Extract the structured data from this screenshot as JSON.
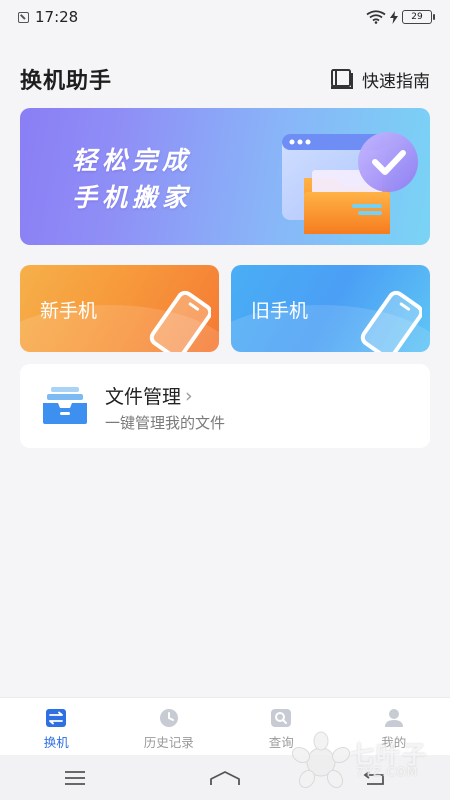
{
  "status_bar": {
    "time": "17:28",
    "battery": "29"
  },
  "header": {
    "title": "换机助手",
    "guide_label": "快速指南"
  },
  "banner": {
    "line1": "轻松完成",
    "line2": "手机搬家"
  },
  "cards": {
    "new_phone": "新手机",
    "old_phone": "旧手机"
  },
  "file_management": {
    "title": "文件管理",
    "subtitle": "一键管理我的文件"
  },
  "tabs": [
    {
      "label": "换机",
      "icon": "swap-icon",
      "active": true
    },
    {
      "label": "历史记录",
      "icon": "clock-icon",
      "active": false
    },
    {
      "label": "查询",
      "icon": "search-icon",
      "active": false
    },
    {
      "label": "我的",
      "icon": "person-icon",
      "active": false
    }
  ],
  "watermark": {
    "text": "七叶子",
    "domain": "7YZ.COM"
  },
  "colors": {
    "accent": "#2f6fe4",
    "new_phone_card": "#f79a3c",
    "old_phone_card": "#4b9ff5",
    "banner_start": "#8a7ef5",
    "banner_end": "#79d4f5"
  }
}
